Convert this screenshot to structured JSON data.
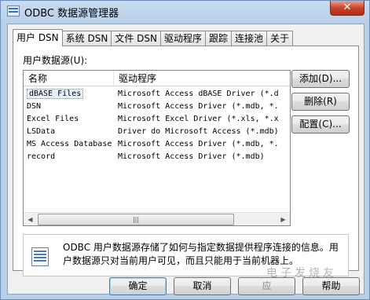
{
  "window": {
    "title": "ODBC 数据源管理器",
    "close_glyph": "✕"
  },
  "tabs": [
    {
      "label": "用户 DSN",
      "active": true
    },
    {
      "label": "系统 DSN",
      "active": false
    },
    {
      "label": "文件 DSN",
      "active": false
    },
    {
      "label": "驱动程序",
      "active": false
    },
    {
      "label": "跟踪",
      "active": false
    },
    {
      "label": "连接池",
      "active": false
    },
    {
      "label": "关于",
      "active": false
    }
  ],
  "panel": {
    "section_label": "用户数据源(U):",
    "columns": {
      "name": "名称",
      "driver": "驱动程序"
    },
    "rows": [
      {
        "name": "dBASE Files",
        "driver": "Microsoft Access dBASE Driver (*.d",
        "selected": true
      },
      {
        "name": "DSN",
        "driver": "Microsoft Access Driver (*.mdb, *."
      },
      {
        "name": "Excel Files",
        "driver": "Microsoft Excel Driver (*.xls, *.x"
      },
      {
        "name": "LSData",
        "driver": "Driver do Microsoft Access (*.mdb)"
      },
      {
        "name": "MS Access Database",
        "driver": "Microsoft Access Driver (*.mdb, *."
      },
      {
        "name": "record",
        "driver": "Microsoft Access Driver (*.mdb)"
      }
    ],
    "scroll": {
      "left": "◀",
      "right": "▶",
      "grip": "|||"
    },
    "buttons": {
      "add": "添加(D)...",
      "remove": "删除(R)",
      "configure": "配置(C)..."
    },
    "info": "ODBC 用户数据源存储了如何与指定数据提供程序连接的信息。用户数据源只对当前用户可见，而且只能用于当前机器上。"
  },
  "footer": {
    "ok": "确定",
    "cancel": "取消",
    "apply": "应",
    "help": "帮助"
  },
  "watermark": "电子发烧友"
}
